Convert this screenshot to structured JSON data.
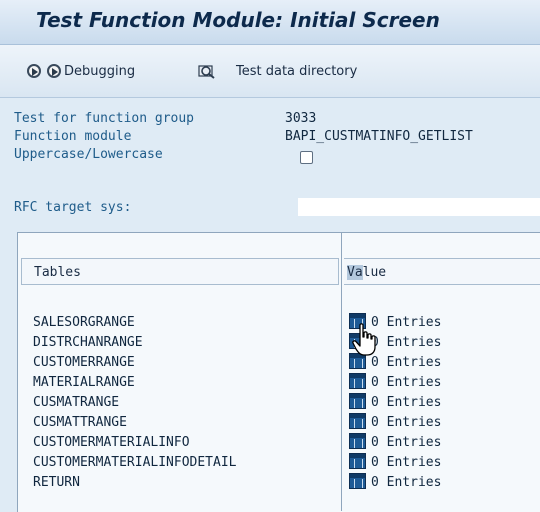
{
  "window": {
    "title": "Test Function Module: Initial Screen"
  },
  "toolbar": {
    "debugging_label": "Debugging",
    "test_data_label": "Test data directory"
  },
  "form": {
    "function_group_label": "Test for function group",
    "function_group_value": "3033",
    "function_module_label": "Function module",
    "function_module_value": "BAPI_CUSTMATINFO_GETLIST",
    "uppercase_label": "Uppercase/Lowercase",
    "uppercase_checked": false,
    "rfc_label": "RFC target sys:",
    "rfc_value": ""
  },
  "tables": {
    "header_tables": "Tables",
    "header_value_highlight": "Va",
    "header_value_rest": "lue",
    "rows": [
      {
        "name": "SALESORGRANGE",
        "value": "0 Entries"
      },
      {
        "name": "DISTRCHANRANGE",
        "value": "0 Entries"
      },
      {
        "name": "CUSTOMERRANGE",
        "value": "0 Entries"
      },
      {
        "name": "MATERIALRANGE",
        "value": "0 Entries"
      },
      {
        "name": "CUSMATRANGE",
        "value": "0 Entries"
      },
      {
        "name": "CUSMATTRANGE",
        "value": "0 Entries"
      },
      {
        "name": "CUSTOMERMATERIALINFO",
        "value": "0 Entries"
      },
      {
        "name": "CUSTOMERMATERIALINFODETAIL",
        "value": "0 Entries"
      },
      {
        "name": "RETURN",
        "value": "0 Entries"
      }
    ]
  }
}
